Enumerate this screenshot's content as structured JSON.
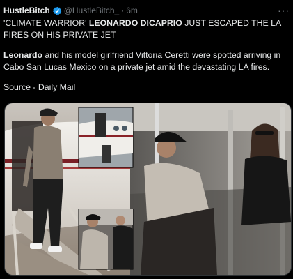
{
  "tweet": {
    "author_name": "HustleBitch",
    "author_handle": "@HustleBitch_",
    "separator": "·",
    "time": "6m",
    "more_label": "···",
    "paragraph1": {
      "part1": "'CLIMATE WARRIOR' ",
      "bold": "LEONARDO DICAPRIO",
      "part2": " JUST ESCAPED THE LA FIRES ON HIS PRIVATE JET"
    },
    "paragraph2": {
      "bold": "Leonardo",
      "part2": " and his model girlfriend Vittoria Ceretti were spotted arriving in Cabo San Lucas Mexico on a private jet amid the devastating LA fires."
    },
    "source": "Source - Daily Mail"
  },
  "colors": {
    "background": "#000000",
    "text": "#e7e9ea",
    "muted": "#71767b",
    "verified": "#1d9bf0",
    "border": "#2f3336"
  },
  "icons": {
    "verified": "verified-badge-icon",
    "more": "more-options-icon"
  }
}
